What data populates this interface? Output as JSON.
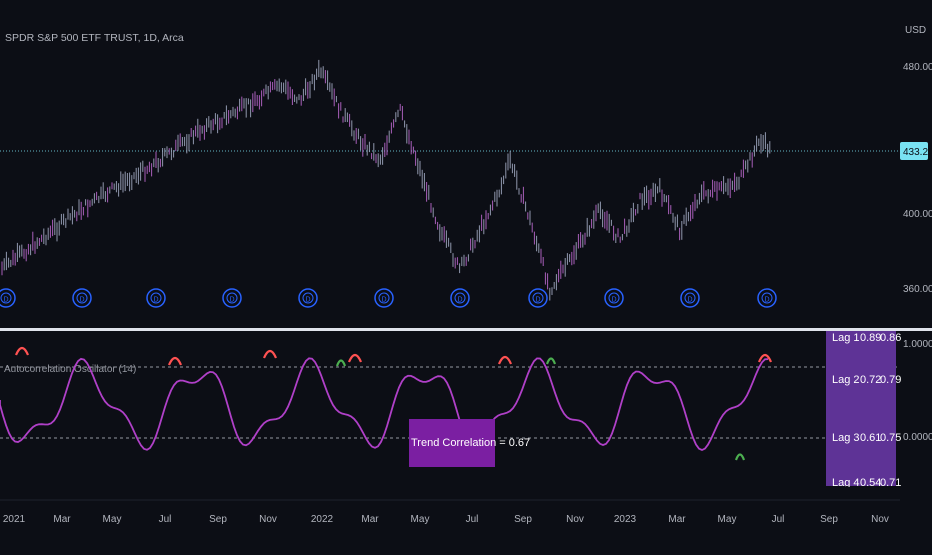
{
  "header": {
    "symbol_label": "SPDR S&P 500 ETF TRUST, 1D, Arca"
  },
  "main_pane": {
    "currency_label": "USD",
    "price_axis_ticks": [
      {
        "label": "480.00",
        "value": 480
      },
      {
        "label": "400.00",
        "value": 400
      },
      {
        "label": "360.00",
        "value": 360
      }
    ],
    "current_price_label": "433.21",
    "current_price": 433.21,
    "dividend_marker_glyph": "D",
    "dividend_markers": [
      "D",
      "D",
      "D",
      "D",
      "D",
      "D",
      "D",
      "D",
      "D",
      "D",
      "D"
    ]
  },
  "indicator_pane": {
    "title": "Autocorrelation Oscillator (14)",
    "axis_ticks": [
      {
        "label": "1.0000",
        "value": 1.0
      },
      {
        "label": "0.0000",
        "value": 0.0
      }
    ],
    "trend_label": "Trend Correlation = 0.67",
    "lag_table": [
      {
        "lag": "Lag 1",
        "a": "0.89",
        "b": "0.86"
      },
      {
        "lag": "Lag 2",
        "a": "0.72",
        "b": "0.79"
      },
      {
        "lag": "Lag 3",
        "a": "0.61",
        "b": "0.75"
      },
      {
        "lag": "Lag 4",
        "a": "0.54",
        "b": "0.71"
      }
    ]
  },
  "time_axis": {
    "labels": [
      "2021",
      "Mar",
      "May",
      "Jul",
      "Sep",
      "Nov",
      "2022",
      "Mar",
      "May",
      "Jul",
      "Sep",
      "Nov",
      "2023",
      "Mar",
      "May",
      "Jul",
      "Sep",
      "Nov"
    ]
  },
  "colors": {
    "background": "#0c0e15",
    "candle_primary": "#a8b0c8",
    "candle_accent": "#c46cd6",
    "price_line": "#79e2f2",
    "dividend": "#2962ff",
    "oscillator": "#b040c8",
    "overbought": "#ff5252",
    "oversold_green": "#4caf50",
    "table_bg": "#5e3396",
    "label_bg": "#7b1fa2"
  }
}
